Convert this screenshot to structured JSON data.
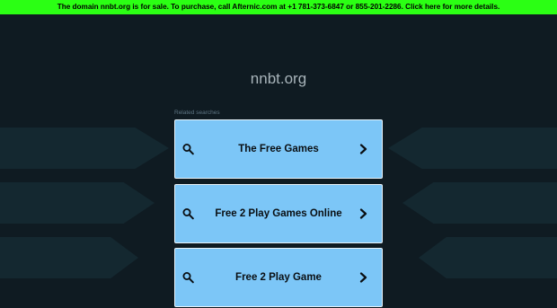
{
  "banner": {
    "text": "The domain nnbt.org is for sale. To purchase, call Afternic.com at +1 781-373-6847 or 855-201-2286. Click here for more details."
  },
  "site": {
    "domain": "nnbt.org"
  },
  "related_label": "Related searches",
  "results": [
    {
      "label": "The Free Games"
    },
    {
      "label": "Free 2 Play Games Online"
    },
    {
      "label": "Free 2 Play Game"
    }
  ],
  "colors": {
    "background": "#0f1b22",
    "banner": "#2bff14",
    "card": "#7cc6f7",
    "card_border": "#e9f4fb"
  },
  "icons": {
    "left": "search-icon",
    "right": "chevron-right-icon"
  }
}
